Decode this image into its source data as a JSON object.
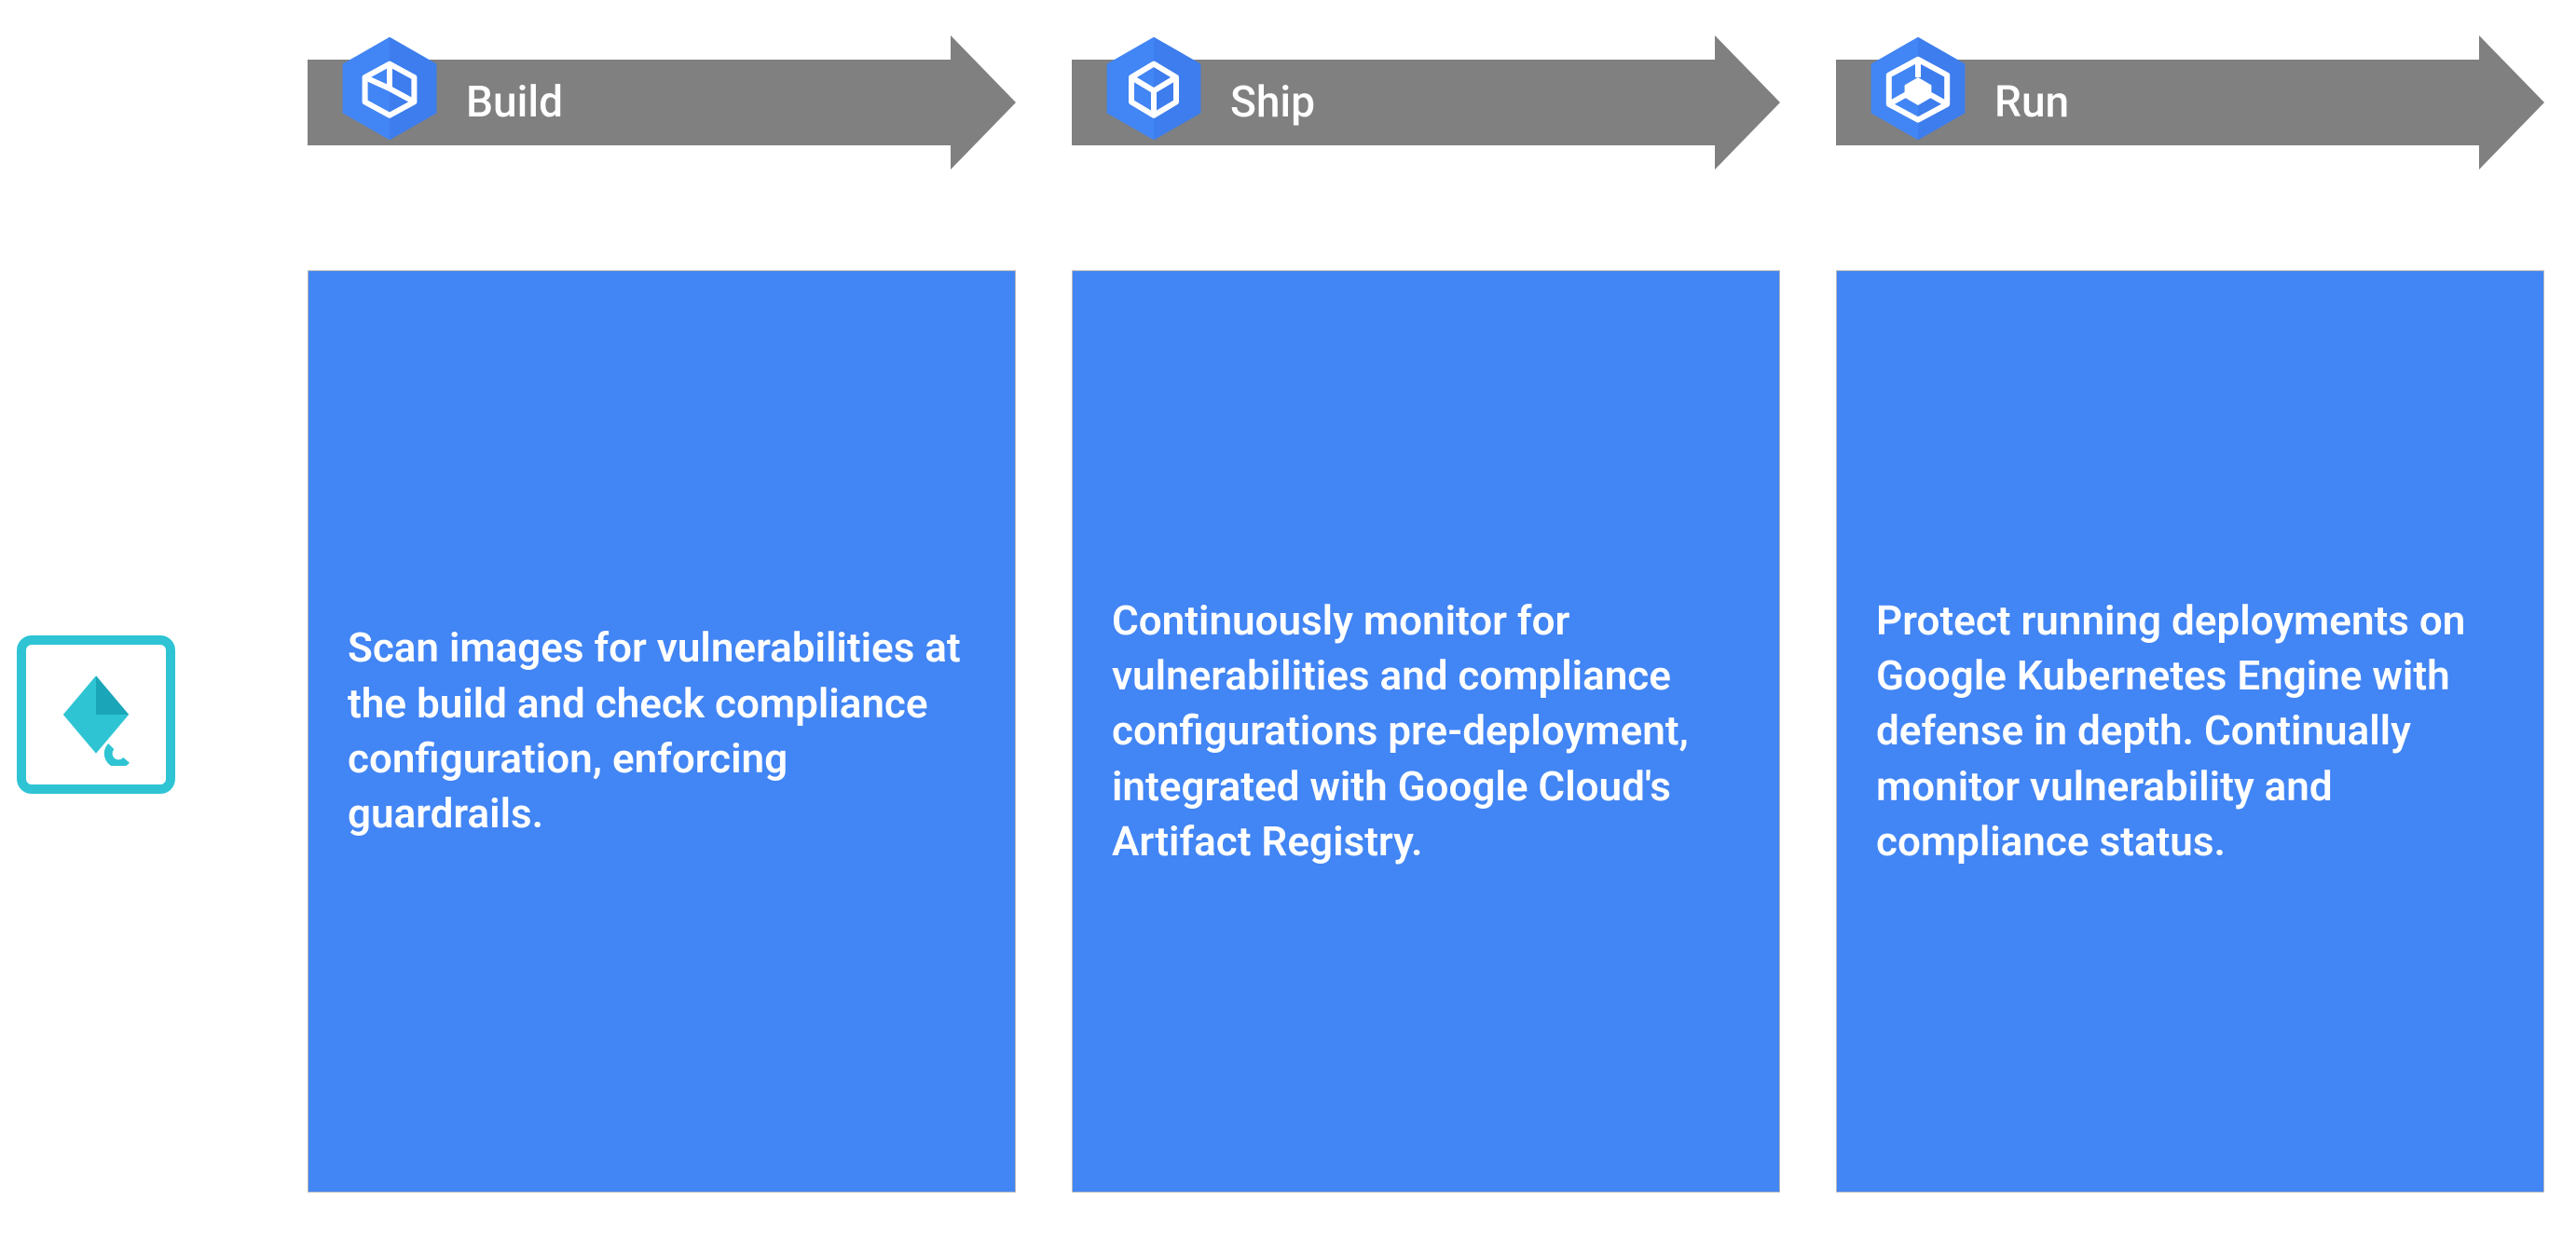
{
  "stages": {
    "build": {
      "title": "Build",
      "body": "Scan images for vulnerabilities at the build and check compliance configuration, enforcing guardrails."
    },
    "ship": {
      "title": "Ship",
      "body": "Continuously monitor for vulnerabilities and compliance configurations pre-deployment, integrated with Google Cloud's Artifact Registry."
    },
    "run": {
      "title": "Run",
      "body": "Protect running deployments on Google Kubernetes Engine with defense in depth. Continually monitor vulnerability and compliance status."
    }
  }
}
